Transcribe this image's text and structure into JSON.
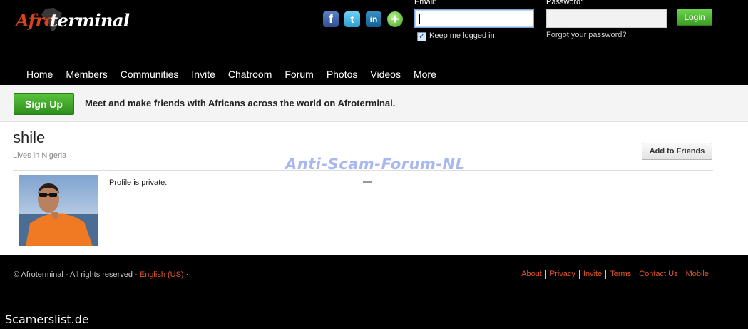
{
  "header": {
    "logo": {
      "part1": "Afro",
      "part2": "terminal"
    },
    "social": {
      "facebook": "f",
      "twitter": "t",
      "linkedin": "in",
      "more": "+"
    },
    "login": {
      "email_label": "Email:",
      "password_label": "Password:",
      "email_value": "",
      "password_value": "",
      "login_label": "Login",
      "keep_logged_in": "Keep me logged in",
      "keep_logged_in_checked": true,
      "forgot_password": "Forgot your password?"
    },
    "nav": [
      "Home",
      "Members",
      "Communities",
      "Invite",
      "Chatroom",
      "Forum",
      "Photos",
      "Videos",
      "More"
    ]
  },
  "signup": {
    "button_label": "Sign Up",
    "tagline": "Meet and make friends with Africans across the world on Afroterminal."
  },
  "profile": {
    "name": "shile",
    "lives_in": "Lives in Nigeria",
    "add_friends_label": "Add to Friends",
    "privacy_text": "Profile is private."
  },
  "watermarks": {
    "top": "Anti-Scam-Forum-NL",
    "bottom": "Scamerslist.de"
  },
  "footer": {
    "copyright": "© Afroterminal - All rights reserved",
    "language": "English (US)",
    "links": [
      "About",
      "Privacy",
      "Invite",
      "Terms",
      "Contact Us",
      "Mobile"
    ]
  },
  "colors": {
    "accent_orange": "#e0562b",
    "button_green": "#3c9d24",
    "watermark_blue": "#a9b8f0"
  }
}
